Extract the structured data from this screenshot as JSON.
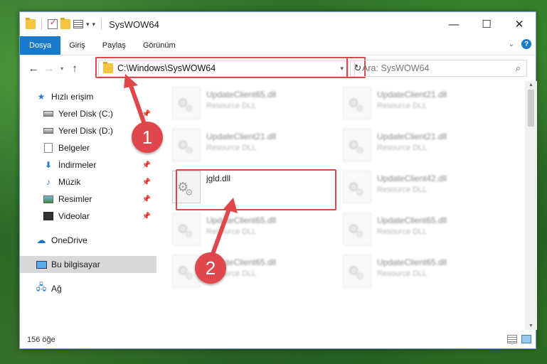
{
  "window": {
    "title": "SysWOW64"
  },
  "ribbon": {
    "tabs": [
      "Dosya",
      "Giriş",
      "Paylaş",
      "Görünüm"
    ]
  },
  "nav": {
    "address_path": "C:\\Windows\\SysWOW64",
    "search_placeholder": "Ara: SysWOW64"
  },
  "sidebar": {
    "quick_access": "Hızlı erişim",
    "items": [
      {
        "label": "Yerel Disk (C:)",
        "icon": "disk-icon",
        "pinned": true
      },
      {
        "label": "Yerel Disk (D:)",
        "icon": "disk-icon",
        "pinned": false
      },
      {
        "label": "Belgeler",
        "icon": "documents-icon",
        "pinned": true
      },
      {
        "label": "İndirmeler",
        "icon": "downloads-icon",
        "pinned": true
      },
      {
        "label": "Müzik",
        "icon": "music-icon",
        "pinned": true
      },
      {
        "label": "Resimler",
        "icon": "pictures-icon",
        "pinned": true
      },
      {
        "label": "Videolar",
        "icon": "videos-icon",
        "pinned": true
      }
    ],
    "onedrive": "OneDrive",
    "this_pc": "Bu bilgisayar",
    "network": "Ağ"
  },
  "files": [
    {
      "name": "UpdateClient65.dll",
      "desc": "Resource DLL"
    },
    {
      "name": "UpdateClient21.dll",
      "desc": "Resource DLL"
    },
    {
      "name": "UpdateClient21.dll",
      "desc": "Resource DLL"
    },
    {
      "name": "UpdateClient21.dll",
      "desc": "Resource DLL"
    },
    {
      "name": "jgld.dll",
      "desc": ""
    },
    {
      "name": "UpdateClient42.dll",
      "desc": "Resource DLL"
    },
    {
      "name": "UpdateClient65.dll",
      "desc": "Resource DLL"
    },
    {
      "name": "UpdateClient65.dll",
      "desc": "Resource DLL"
    },
    {
      "name": "UpdateClient65.dll",
      "desc": "Resource DLL"
    },
    {
      "name": "UpdateClient65.dll",
      "desc": "Resource DLL"
    }
  ],
  "status": {
    "item_count": "156 öğe"
  },
  "annotations": {
    "step1": "1",
    "step2": "2",
    "color": "#e0474c"
  }
}
